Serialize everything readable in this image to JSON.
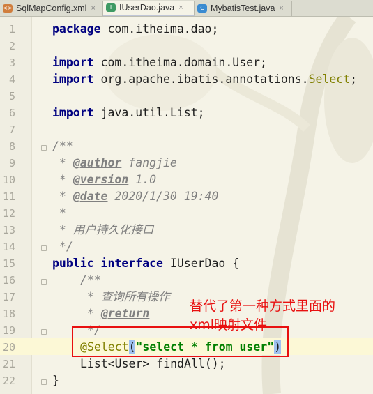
{
  "tabs": [
    {
      "label": "SqlMapConfig.xml",
      "icon": "xml-file-icon",
      "active": false
    },
    {
      "label": "IUserDao.java",
      "icon": "interface-file-icon",
      "active": true
    },
    {
      "label": "MybatisTest.java",
      "icon": "class-file-icon",
      "active": false
    }
  ],
  "tab_close_glyph": "×",
  "type_badges": {
    "xml": "<>",
    "interface": "I",
    "class": "C"
  },
  "code": {
    "line_numbers": [
      "1",
      "2",
      "3",
      "4",
      "5",
      "6",
      "7",
      "8",
      "9",
      "10",
      "11",
      "12",
      "13",
      "14",
      "15",
      "16",
      "17",
      "18",
      "19",
      "20",
      "21",
      "22"
    ],
    "l1": {
      "kw": "package",
      "rest": " com.itheima.dao;"
    },
    "l3": {
      "kw": "import",
      "rest": " com.itheima.domain.User;"
    },
    "l4": {
      "kw": "import",
      "rest": " org.apache.ibatis.annotations.",
      "ann": "Select",
      "end": ";"
    },
    "l6": {
      "kw": "import",
      "rest": " java.util.List;"
    },
    "l8": "/**",
    "l9": {
      "star": " * ",
      "tag": "@author",
      "text": " fangjie"
    },
    "l10": {
      "star": " * ",
      "tag": "@version",
      "text": " 1.0"
    },
    "l11": {
      "star": " * ",
      "tag": "@date",
      "text": " 2020/1/30 19:40"
    },
    "l12": " *",
    "l13": " * 用户持久化接口",
    "l14": " */",
    "l15": {
      "kw": "public interface",
      "rest": " IUserDao {"
    },
    "l16": "/**",
    "l17": " * 查询所有操作",
    "l18": {
      "star": " * ",
      "tag": "@return"
    },
    "l19": " */",
    "l20": {
      "ann": "@Select",
      "open": "(",
      "str": "\"select * from user\"",
      "close": ")"
    },
    "l21": "List<User> findAll();",
    "l22": "}"
  },
  "annotation": {
    "line1": "替代了第一种方式里面的",
    "line2": "xml映射文件",
    "color": "#e81010"
  },
  "colors": {
    "keyword": "#000080",
    "comment": "#808080",
    "annotation": "#808000",
    "string": "#007f00",
    "current_line": "#fcf8d6",
    "background": "#f5f3e7"
  }
}
